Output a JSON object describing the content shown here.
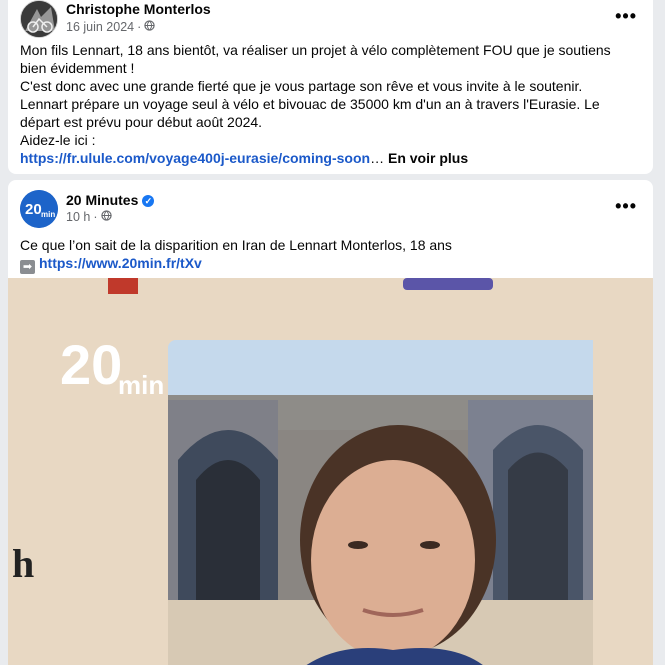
{
  "post1": {
    "author": "Christophe Monterlos",
    "date": "16 juin 2024",
    "text_lines": [
      "Mon fils Lennart, 18 ans bientôt, va réaliser un projet à vélo complètement FOU que je soutiens",
      "bien évidemment !",
      "C'est donc avec une grande fierté que je vous partage son rêve et vous invite à le soutenir.",
      "Lennart prépare un voyage seul à vélo et bivouac de 35000 km d'un an à travers l'Eurasie. Le",
      "départ est prévu pour début août 2024.",
      "Aidez-le ici :"
    ],
    "link": "https://fr.ulule.com/voyage400j-eurasie/coming-soon",
    "ellipsis": "…",
    "see_more": "En voir plus"
  },
  "post2": {
    "author": "20 Minutes",
    "avatar_text": "20",
    "avatar_sub": "min",
    "time": "10 h",
    "text": "Ce que l’on sait de la disparition en Iran de Lennart Monterlos, 18 ans",
    "link": "https://www.20min.fr/tXv",
    "media_logo_main": "20",
    "media_logo_sub": "min",
    "media_side_letter": "h"
  },
  "icons": {
    "globe": "globe-icon",
    "more": "more-options-icon",
    "verified": "verified-badge-icon",
    "arrow": "right-arrow-icon"
  },
  "colors": {
    "link": "#1b59c9",
    "brand_blue": "#1d64c9",
    "verified": "#1877f2",
    "secondary_text": "#65676b"
  }
}
